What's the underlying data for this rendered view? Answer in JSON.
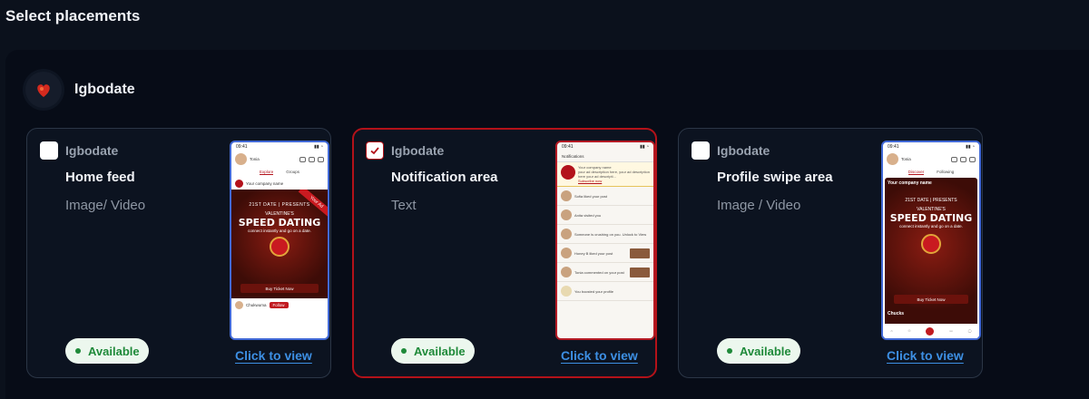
{
  "page_title": "Select placements",
  "brand": {
    "name": "Igbodate"
  },
  "status_label": "Available",
  "view_label": "Click to view",
  "cards": [
    {
      "brand": "Igbodate",
      "title": "Home feed",
      "subtitle": "Image/ Video",
      "checked": false
    },
    {
      "brand": "Igbodate",
      "title": "Notification area",
      "subtitle": "Text",
      "checked": true
    },
    {
      "brand": "Igbodate",
      "title": "Profile swipe area",
      "subtitle": "Image / Video",
      "checked": false
    }
  ],
  "preview": {
    "time": "09:41",
    "user": "Tonia",
    "tabs_feed": [
      "Explore",
      "Groups"
    ],
    "tabs_swipe": [
      "Discover",
      "Following"
    ],
    "company": "Your company name",
    "ad_line1": "21ST DATE | PRESENTS",
    "ad_line2": "VALENTINE'S",
    "ad_headline": "SPEED DATING",
    "ad_tagline": "connect instantly and go on a date.",
    "ad_button": "Buy Ticket Now",
    "ribbon": "Your Ad",
    "feed_user": "Chukwuma",
    "follow": "Follow",
    "notifications_title": "Notifications",
    "notif_ad_text": "your ad description here, your ad description here your ad descripti...",
    "subscribe": "Subscribe now",
    "notifs": [
      "Sofia liked your post",
      "Anita visited you",
      "Someone is crushing on you. Unlock to View",
      "Honey B liked your post",
      "Tonia commented on your post",
      "You boosted your profile"
    ],
    "swipe_name": "Chucks"
  },
  "colors": {
    "accent": "#b31219",
    "available": "#1f8a3a",
    "link": "#3d8fe3"
  },
  "icons": {
    "checkbox_checked": "check-icon",
    "brand_logo": "heart-logo-icon"
  }
}
